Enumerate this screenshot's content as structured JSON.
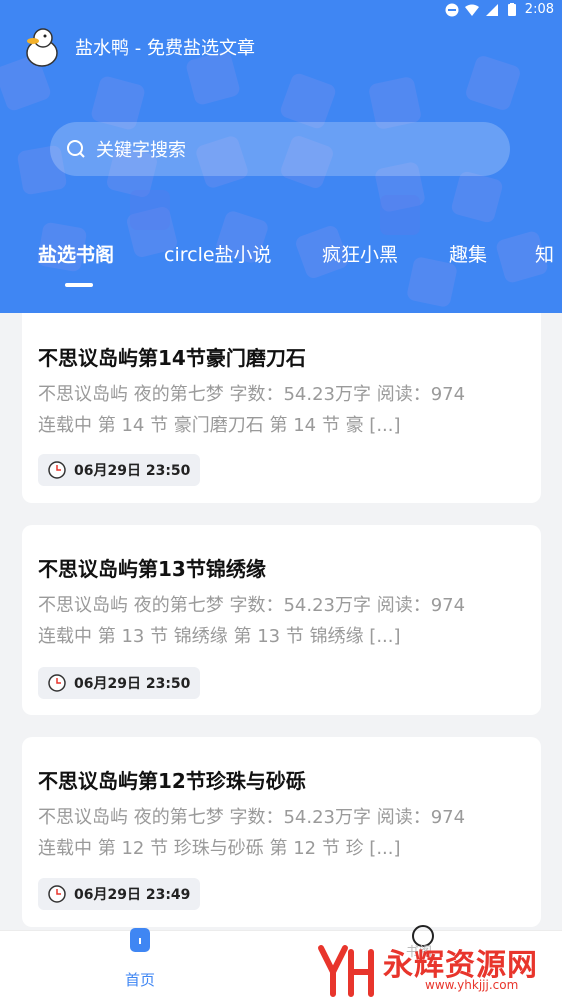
{
  "status_bar": {
    "time": "2:08"
  },
  "app": {
    "title": "盐水鸭 - 免费盐选文章"
  },
  "search": {
    "placeholder": "关键字搜索"
  },
  "tabs": [
    {
      "label": "盐选书阁",
      "active": true
    },
    {
      "label": "circle盐小说",
      "active": false
    },
    {
      "label": "疯狂小黑",
      "active": false
    },
    {
      "label": "趣集",
      "active": false
    },
    {
      "label": "知",
      "active": false
    }
  ],
  "articles": [
    {
      "title": "不思议岛屿第14节豪门磨刀石",
      "desc_line1": "不思议岛屿 夜的第七梦 字数：54.23万字 阅读：974",
      "desc_line2": "连载中 第 14 节 豪门磨刀石 第 14 节 豪 [...]",
      "time": "06月29日 23:50"
    },
    {
      "title": "不思议岛屿第13节锦绣缘",
      "desc_line1": "不思议岛屿 夜的第七梦 字数：54.23万字 阅读：974",
      "desc_line2": "连载中 第 13 节 锦绣缘 第 13 节 锦绣缘 [...]",
      "time": "06月29日 23:50"
    },
    {
      "title": "不思议岛屿第12节珍珠与砂砾",
      "desc_line1": "不思议岛屿 夜的第七梦 字数：54.23万字 阅读：974",
      "desc_line2": "连载中 第 12 节 珍珠与砂砾 第 12 节 珍 [...]",
      "time": "06月29日 23:49"
    }
  ],
  "bottom_nav": {
    "home": "首页",
    "second": "书阁"
  },
  "watermark": {
    "text": "永辉资源网",
    "url": "www.yhkjjj.com"
  },
  "colors": {
    "brand": "#3f86f3",
    "watermark": "#e8352c"
  }
}
